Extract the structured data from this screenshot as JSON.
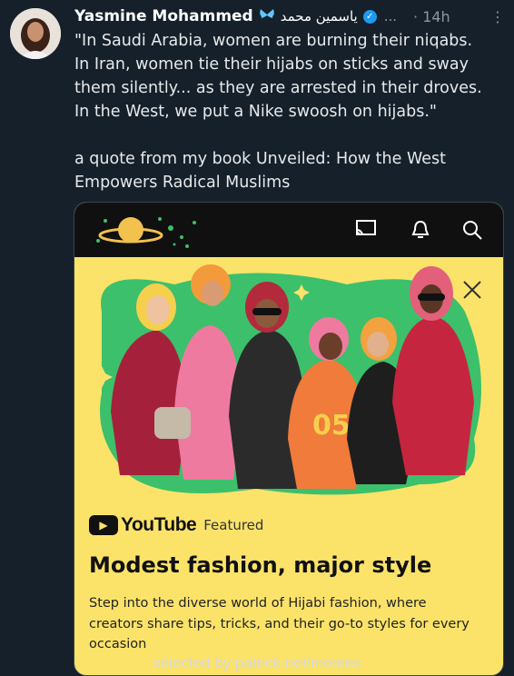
{
  "post": {
    "author_name": "Yasmine Mohammed",
    "butterfly_icon": "butterfly-icon",
    "author_arabic": "ياسمين محمد",
    "verified_icon": "verified-badge-icon",
    "ellipsis": "...",
    "time": "· 14h",
    "more": "⋮",
    "quote_lines": [
      "\"In Saudi Arabia, women are burning their niqabs.",
      "In Iran, women tie their hijabs on sticks and sway",
      "them silently... as they are arrested in their droves.",
      "In the West, we put a Nike swoosh on hijabs.\""
    ],
    "book_lines": [
      "a quote from my book Unveiled: How the West",
      "Empowers Radical Muslims"
    ]
  },
  "card": {
    "icons": [
      "cast-icon",
      "bell-icon",
      "search-icon",
      "close-icon"
    ],
    "brand": "YouTube",
    "featured": "Featured",
    "title": "Modest fashion, major style",
    "description_lines": [
      "Step into the diverse world of Hijabi fashion, where",
      "creators share tips, tricks, and their go-to styles for every",
      "occasion"
    ],
    "jersey_number": "05"
  },
  "watermark": "selected by patrick.net/memes",
  "colors": {
    "background": "#15202b",
    "card_yellow": "#fbe36a",
    "verified_blue": "#1d9bf0"
  }
}
